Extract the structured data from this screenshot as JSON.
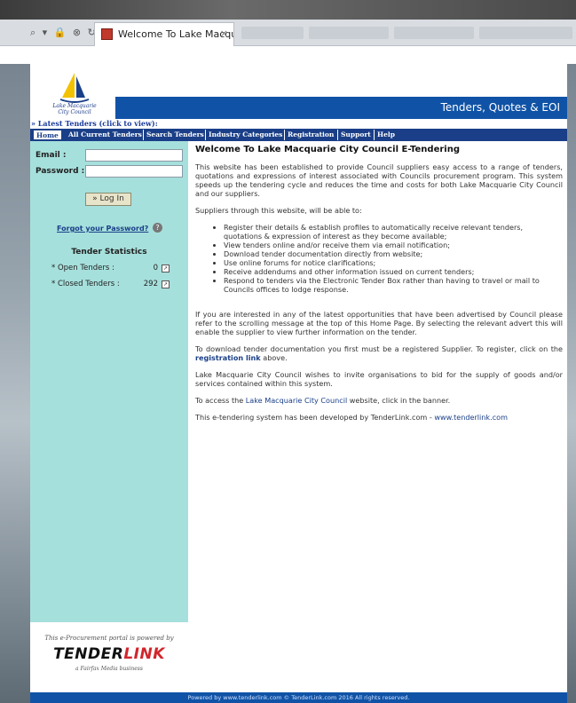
{
  "browser": {
    "nav_icons": "⌕ ▾ 🔒 ⊗ ↻",
    "tab_title": "Welcome To Lake Macquar...",
    "tab_close": "×"
  },
  "site": {
    "logo_text_line1": "Lake Macquarie",
    "logo_text_line2": "City Council",
    "banner_title": "Tenders, Quotes & EOI",
    "latest_tenders": "» Latest Tenders (click to view):",
    "menu": [
      "Home",
      "All Current Tenders",
      "Search Tenders",
      "Industry Categories",
      "Registration",
      "Support",
      "Help"
    ],
    "login": {
      "email_label": "Email :",
      "password_label": "Password :",
      "button_label": "» Log In",
      "forgot_label": "Forgot your Password?",
      "help_symbol": "?"
    },
    "stats": {
      "title": "Tender Statistics",
      "open_label": "* Open Tenders :",
      "open_value": "0",
      "closed_label": "* Closed Tenders :",
      "closed_value": "292"
    },
    "tenderlink": {
      "powered": "This e-Procurement portal is powered by",
      "logo_a": "TENDER",
      "logo_b": "LINK",
      "sub": "a Fairfax Media business"
    },
    "main": {
      "title": "Welcome To Lake Macquarie City Council E-Tendering",
      "p1": "This website has been established to provide Council suppliers easy access to a range of tenders, quotations and expressions of interest associated with Councils procurement program. This system speeds up the tendering cycle and reduces the time and costs for both Lake Macquarie City Council and our suppliers.",
      "p2": "Suppliers through this website, will be able to:",
      "bullets": [
        "Register their details & establish profiles to automatically receive relevant tenders, quotations & expression of interest as they become available;",
        "View tenders online and/or receive them via email notification;",
        "Download tender documentation directly from website;",
        "Use online forums for notice clarifications;",
        "Receive addendums and other information issued on current tenders;",
        "Respond to tenders via the Electronic Tender Box rather than having to travel or mail to Councils offices to lodge response."
      ],
      "p3": "If you are interested in any of the latest opportunities that have been advertised by Council please refer to the scrolling message at the top of this Home Page. By selecting the relevant advert this will enable the supplier to view further information on the tender.",
      "p4_a": "To download tender documentation you first must be a registered Supplier. To register, click on the ",
      "p4_link": "registration link",
      "p4_b": " above.",
      "p5": "Lake Macquarie City Council wishes to invite organisations to bid for the supply of goods and/or services contained within this system.",
      "p6_a": "To access the ",
      "p6_link": "Lake Macquarie City Council",
      "p6_b": " website, click in the banner.",
      "p7_a": "This e-tendering system has been developed by TenderLink.com - ",
      "p7_link": "www.tenderlink.com"
    },
    "footer": "Powered by www.tenderlink.com    © TenderLink.com 2016 All rights reserved."
  }
}
